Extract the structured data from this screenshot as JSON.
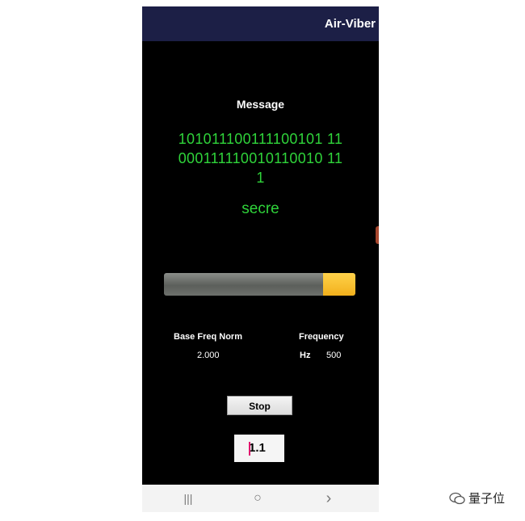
{
  "app": {
    "title": "Air-Viber"
  },
  "message": {
    "label": "Message",
    "bits_lines": [
      "101011100111100101 11",
      "000111110010110010 11",
      "1"
    ],
    "decoded": "secre"
  },
  "progress": {
    "fraction": 0.83,
    "bar_color": "#6b6e6a",
    "fill_color": "#f5b82a"
  },
  "stats": {
    "base_freq_label": "Base Freq Norm",
    "base_freq_value": "2.000",
    "frequency_label": "Frequency",
    "frequency_unit": "Hz",
    "frequency_value": "500"
  },
  "controls": {
    "stop_label": "Stop",
    "input_value": "1.1"
  },
  "navbar": {
    "recents_glyph": "|||",
    "home_glyph": "○",
    "back_glyph": "›"
  },
  "watermark": {
    "text": "量子位"
  },
  "colors": {
    "accent_green": "#2fd33a",
    "appbar": "#1c1f46"
  }
}
